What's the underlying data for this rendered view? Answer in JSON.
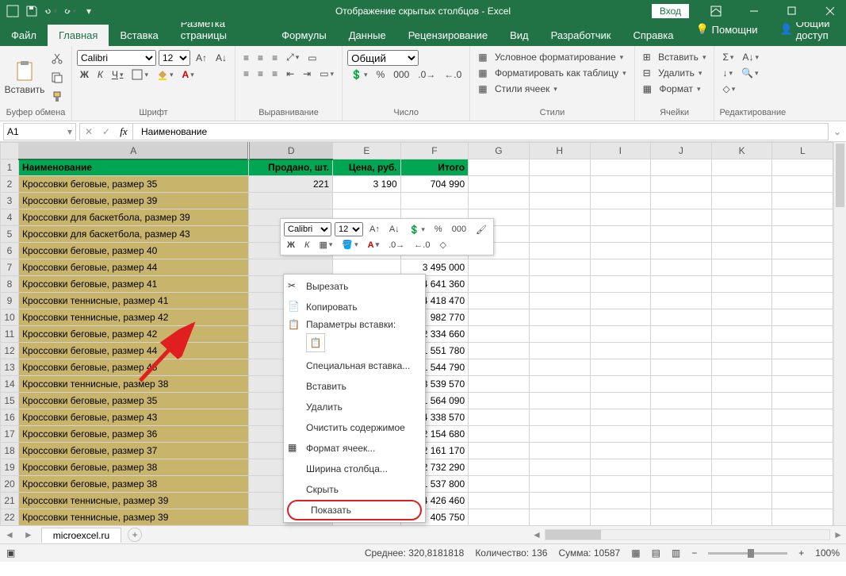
{
  "titlebar": {
    "title": "Отображение скрытых столбцов  -  Excel",
    "login": "Вход"
  },
  "tabs": {
    "file": "Файл",
    "home": "Главная",
    "insert": "Вставка",
    "layout": "Разметка страницы",
    "formulas": "Формулы",
    "data": "Данные",
    "review": "Рецензирование",
    "view": "Вид",
    "developer": "Разработчик",
    "help": "Справка",
    "assistant": "Помощни",
    "share": "Общий доступ"
  },
  "ribbon": {
    "clipboard": {
      "paste": "Вставить",
      "label": "Буфер обмена"
    },
    "font": {
      "name": "Calibri",
      "size": "12",
      "label": "Шрифт",
      "bold": "Ж",
      "italic": "К",
      "underline": "Ч"
    },
    "align": {
      "label": "Выравнивание"
    },
    "number": {
      "format": "Общий",
      "label": "Число"
    },
    "styles": {
      "cond": "Условное форматирование",
      "table": "Форматировать как таблицу",
      "cell": "Стили ячеек",
      "label": "Стили"
    },
    "cells": {
      "insert": "Вставить",
      "delete": "Удалить",
      "format": "Формат",
      "label": "Ячейки"
    },
    "editing": {
      "label": "Редактирование"
    }
  },
  "fbar": {
    "name": "A1",
    "formula": "Наименование"
  },
  "columns": [
    "A",
    "D",
    "E",
    "F",
    "G",
    "H",
    "I",
    "J",
    "K",
    "L"
  ],
  "headers": {
    "a": "Наименование",
    "d": "Продано, шт.",
    "e": "Цена, руб.",
    "f": "Итого"
  },
  "rows": [
    {
      "n": 2,
      "a": "Кроссовки беговые, размер 35",
      "d": "221",
      "e": "3 190",
      "f": "704 990"
    },
    {
      "n": 3,
      "a": "Кроссовки беговые, размер 39",
      "d": "",
      "e": "",
      "f": ""
    },
    {
      "n": 4,
      "a": "Кроссовки для баскетбола, размер 39",
      "d": "",
      "e": "",
      "f": ""
    },
    {
      "n": 5,
      "a": "Кроссовки для баскетбола, размер 43",
      "d": "",
      "e": "",
      "f": ""
    },
    {
      "n": 6,
      "a": "Кроссовки беговые, размер 40",
      "d": "321",
      "e": "6 490",
      "f": "2 083 290"
    },
    {
      "n": 7,
      "a": "Кроссовки беговые, размер 44",
      "d": "",
      "e": "",
      "f": "3 495 000"
    },
    {
      "n": 8,
      "a": "Кроссовки беговые, размер 41",
      "d": "",
      "e": "",
      "f": "4 641 360"
    },
    {
      "n": 9,
      "a": "Кроссовки теннисные, размер 41",
      "d": "",
      "e": "",
      "f": "4 418 470"
    },
    {
      "n": 10,
      "a": "Кроссовки теннисные, размер 42",
      "d": "",
      "e": "",
      "f": "982 770"
    },
    {
      "n": 11,
      "a": "Кроссовки беговые, размер 42",
      "d": "",
      "e": "",
      "f": "2 334 660"
    },
    {
      "n": 12,
      "a": "Кроссовки беговые, размер 44",
      "d": "",
      "e": "",
      "f": "1 551 780"
    },
    {
      "n": 13,
      "a": "Кроссовки беговые, размер 45",
      "d": "",
      "e": "",
      "f": "1 544 790"
    },
    {
      "n": 14,
      "a": "Кроссовки теннисные, размер 38",
      "d": "",
      "e": "",
      "f": "3 539 570"
    },
    {
      "n": 15,
      "a": "Кроссовки беговые, размер 35",
      "d": "",
      "e": "",
      "f": "1 564 090"
    },
    {
      "n": 16,
      "a": "Кроссовки беговые, размер 43",
      "d": "",
      "e": "",
      "f": "4 338 570"
    },
    {
      "n": 17,
      "a": "Кроссовки беговые, размер 36",
      "d": "",
      "e": "",
      "f": "2 154 680"
    },
    {
      "n": 18,
      "a": "Кроссовки беговые, размер 37",
      "d": "",
      "e": "",
      "f": "2 161 170"
    },
    {
      "n": 19,
      "a": "Кроссовки беговые, размер 38",
      "d": "",
      "e": "",
      "f": "2 732 290"
    },
    {
      "n": 20,
      "a": "Кроссовки беговые, размер 38",
      "d": "",
      "e": "",
      "f": "1 537 800"
    },
    {
      "n": 21,
      "a": "Кроссовки теннисные, размер 39",
      "d": "554",
      "e": "7 990",
      "f": "4 426 460"
    },
    {
      "n": 22,
      "a": "Кроссовки теннисные, размер 39",
      "d": "125",
      "e": "3 000",
      "f": "405 750"
    }
  ],
  "sheet": {
    "name": "microexcel.ru"
  },
  "status": {
    "avg_label": "Среднее:",
    "avg": "320,8181818",
    "count_label": "Количество:",
    "count": "136",
    "sum_label": "Сумма:",
    "sum": "10587",
    "zoom": "100%"
  },
  "mini": {
    "font": "Calibri",
    "size": "12",
    "bold": "Ж",
    "italic": "К",
    "percent": "%",
    "thousands": "000"
  },
  "ctx": {
    "cut": "Вырезать",
    "copy": "Копировать",
    "paste_label": "Параметры вставки:",
    "paste_special": "Специальная вставка...",
    "insert": "Вставить",
    "delete": "Удалить",
    "clear": "Очистить содержимое",
    "format_cells": "Формат ячеек...",
    "col_width": "Ширина столбца...",
    "hide": "Скрыть",
    "show": "Показать"
  }
}
